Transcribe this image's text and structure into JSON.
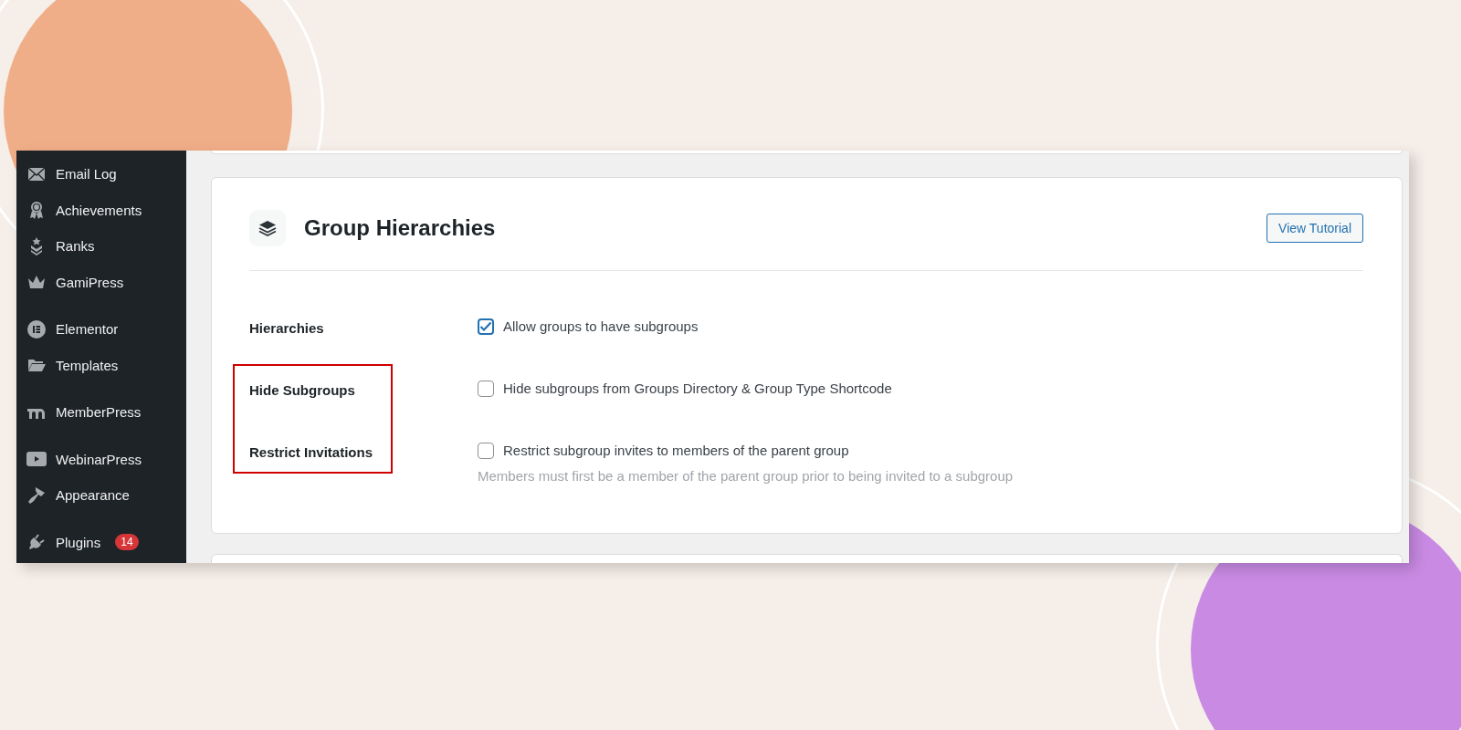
{
  "sidebar": {
    "groups": [
      {
        "items": [
          {
            "label": "Email Log"
          },
          {
            "label": "Achievements"
          },
          {
            "label": "Ranks"
          },
          {
            "label": "GamiPress"
          }
        ]
      },
      {
        "items": [
          {
            "label": "Elementor"
          },
          {
            "label": "Templates"
          }
        ]
      },
      {
        "items": [
          {
            "label": "MemberPress"
          }
        ]
      },
      {
        "items": [
          {
            "label": "WebinarPress"
          },
          {
            "label": "Appearance"
          }
        ]
      },
      {
        "items": [
          {
            "label": "Plugins",
            "badge": "14"
          }
        ]
      }
    ]
  },
  "panel": {
    "title": "Group Hierarchies",
    "button": "View Tutorial",
    "settings": [
      {
        "label": "Hierarchies",
        "checked": true,
        "option": "Allow groups to have subgroups",
        "highlighted": false
      },
      {
        "label": "Hide Subgroups",
        "checked": false,
        "option": "Hide subgroups from Groups Directory & Group Type Shortcode",
        "highlighted": true
      },
      {
        "label": "Restrict Invitations",
        "checked": false,
        "option": "Restrict subgroup invites to members of the parent group",
        "description": "Members must first be a member of the parent group prior to being invited to a subgroup",
        "highlighted": true
      }
    ]
  }
}
